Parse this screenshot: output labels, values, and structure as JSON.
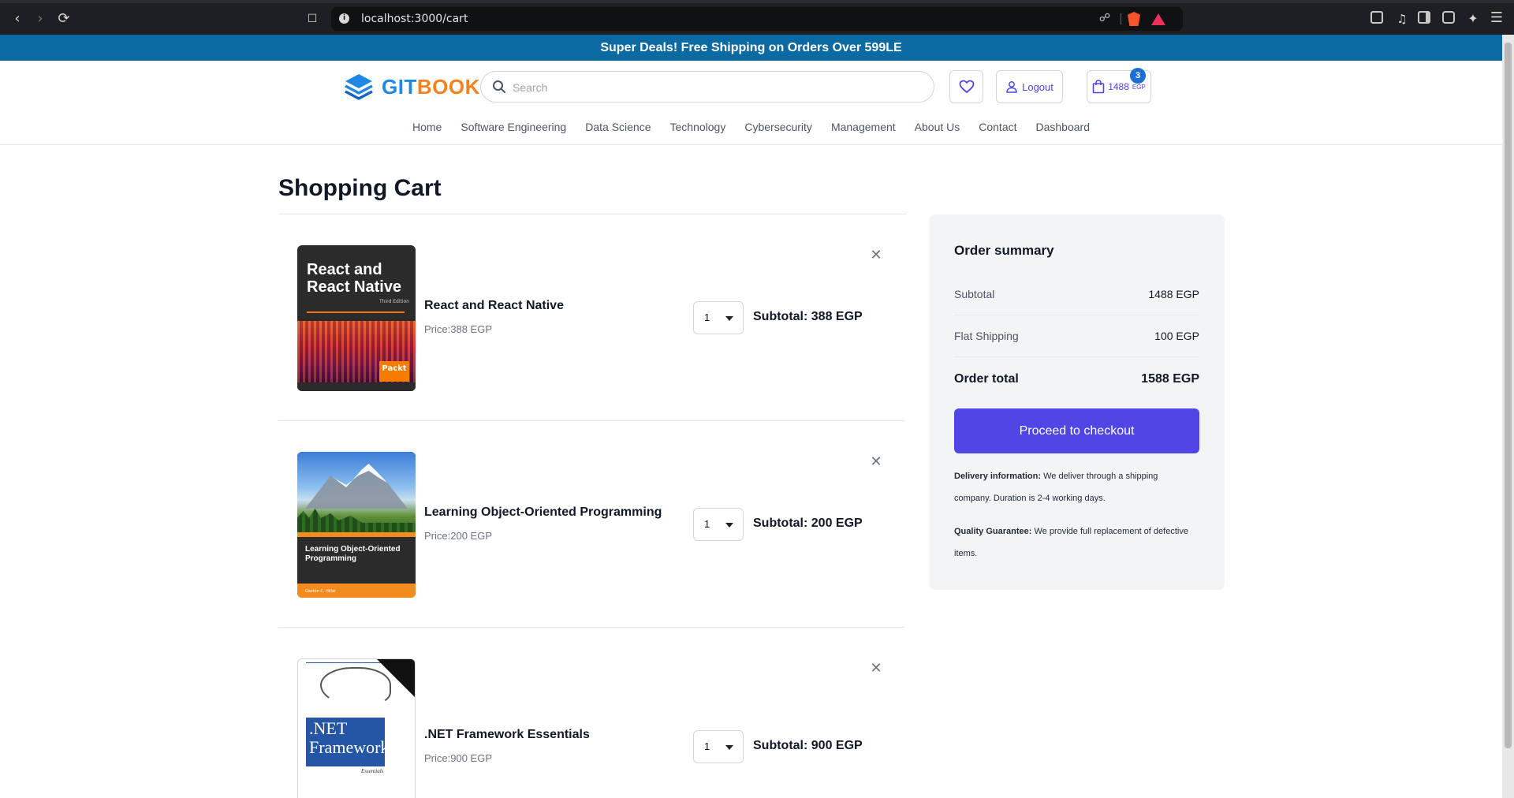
{
  "browser": {
    "url": "localhost:3000/cart"
  },
  "promo": {
    "text": "Super Deals! Free Shipping on Orders Over 599LE"
  },
  "header": {
    "logo_part1": "GIT",
    "logo_part2": "BOOK",
    "search_placeholder": "Search",
    "logout_label": "Logout",
    "cart_amount": "1488",
    "cart_currency": "EGP",
    "cart_count": "3"
  },
  "nav": [
    {
      "label": "Home"
    },
    {
      "label": "Software Engineering"
    },
    {
      "label": "Data Science"
    },
    {
      "label": "Technology"
    },
    {
      "label": "Cybersecurity"
    },
    {
      "label": "Management"
    },
    {
      "label": "About Us"
    },
    {
      "label": "Contact"
    },
    {
      "label": "Dashboard"
    }
  ],
  "cart": {
    "title": "Shopping Cart",
    "items": [
      {
        "name": "React and React Native",
        "price": "Price:388 EGP",
        "quantity": "1",
        "subtotal": "Subtotal: 388 EGP",
        "cover_title": "React and React Native",
        "cover_edition": "Third Edition",
        "cover_publisher": "Packt"
      },
      {
        "name": "Learning Object-Oriented Programming",
        "price": "Price:200 EGP",
        "quantity": "1",
        "subtotal": "Subtotal: 200 EGP",
        "cover_title": "Learning Object-Oriented Programming",
        "cover_author": "Gastón C. Hillar"
      },
      {
        "name": ".NET Framework Essentials",
        "price": "Price:900 EGP",
        "quantity": "1",
        "subtotal": "Subtotal: 900 EGP",
        "cover_title": ".NET Framework",
        "cover_subtitle": "Essentials"
      }
    ]
  },
  "summary": {
    "title": "Order summary",
    "subtotal_label": "Subtotal",
    "subtotal_value": "1488 EGP",
    "shipping_label": "Flat Shipping",
    "shipping_value": "100 EGP",
    "total_label": "Order total",
    "total_value": "1588 EGP",
    "checkout_label": "Proceed to checkout",
    "delivery_title": "Delivery information:",
    "delivery_text": " We deliver through a shipping company. Duration is 2-4 working days.",
    "quality_title": "Quality Guarantee:",
    "quality_text": " We provide full replacement of defective items."
  },
  "colors": {
    "promo_bg": "#0b6aa2",
    "accent": "#4f46e5",
    "logo_blue": "#1e88e5",
    "logo_orange": "#f5821f"
  }
}
